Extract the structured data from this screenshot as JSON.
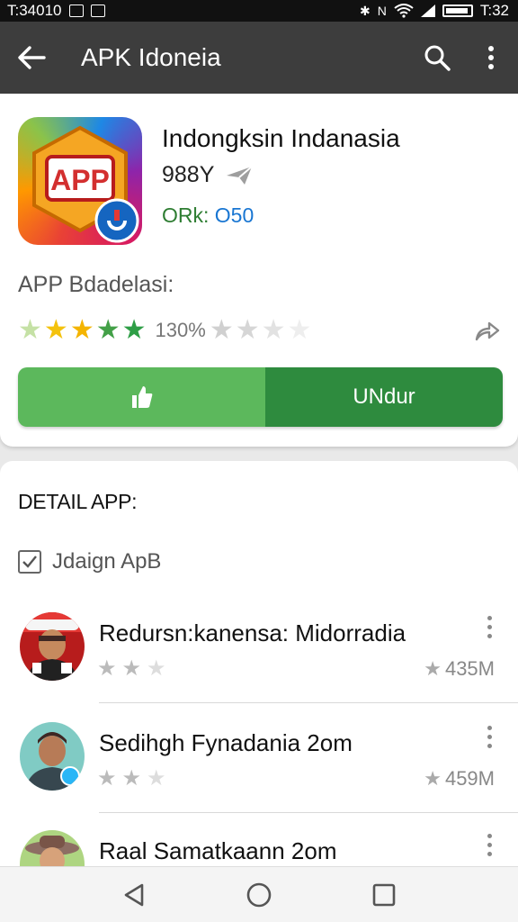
{
  "status_bar": {
    "left_time": "T:34010",
    "right_time": "T:32"
  },
  "app_bar": {
    "title": "APK Idoneia",
    "back_icon": "back-arrow-icon",
    "search_icon": "search-icon",
    "more_icon": "more-vert-icon"
  },
  "app": {
    "name": "Indongksin Indanasia",
    "version": "988Y",
    "meta_green": "ORk:",
    "meta_blue": "O50",
    "section_label": "APP Bdadelasi:",
    "rating_text": "130%",
    "rating_stars_filled": 5,
    "download_label": "UNdur",
    "icon_label": "APP"
  },
  "detail": {
    "title": "DETAIL APP:",
    "checkbox_label": "Jdaign ApB",
    "checkbox_checked": true
  },
  "list": [
    {
      "name": "Redursn:kanensa: Midorradia",
      "size": "435M",
      "stars_filled": 2
    },
    {
      "name": "Sedihgh Fynadania 2om",
      "size": "459M",
      "stars_filled": 2
    },
    {
      "name": "Raal Samatkaann 2om"
    }
  ],
  "colors": {
    "app_bar": "#3d3d3d",
    "download_left": "#5cb85c",
    "download_right": "#2e8b3e",
    "star_green": "#43a047",
    "star_yellow": "#f4c20d"
  }
}
